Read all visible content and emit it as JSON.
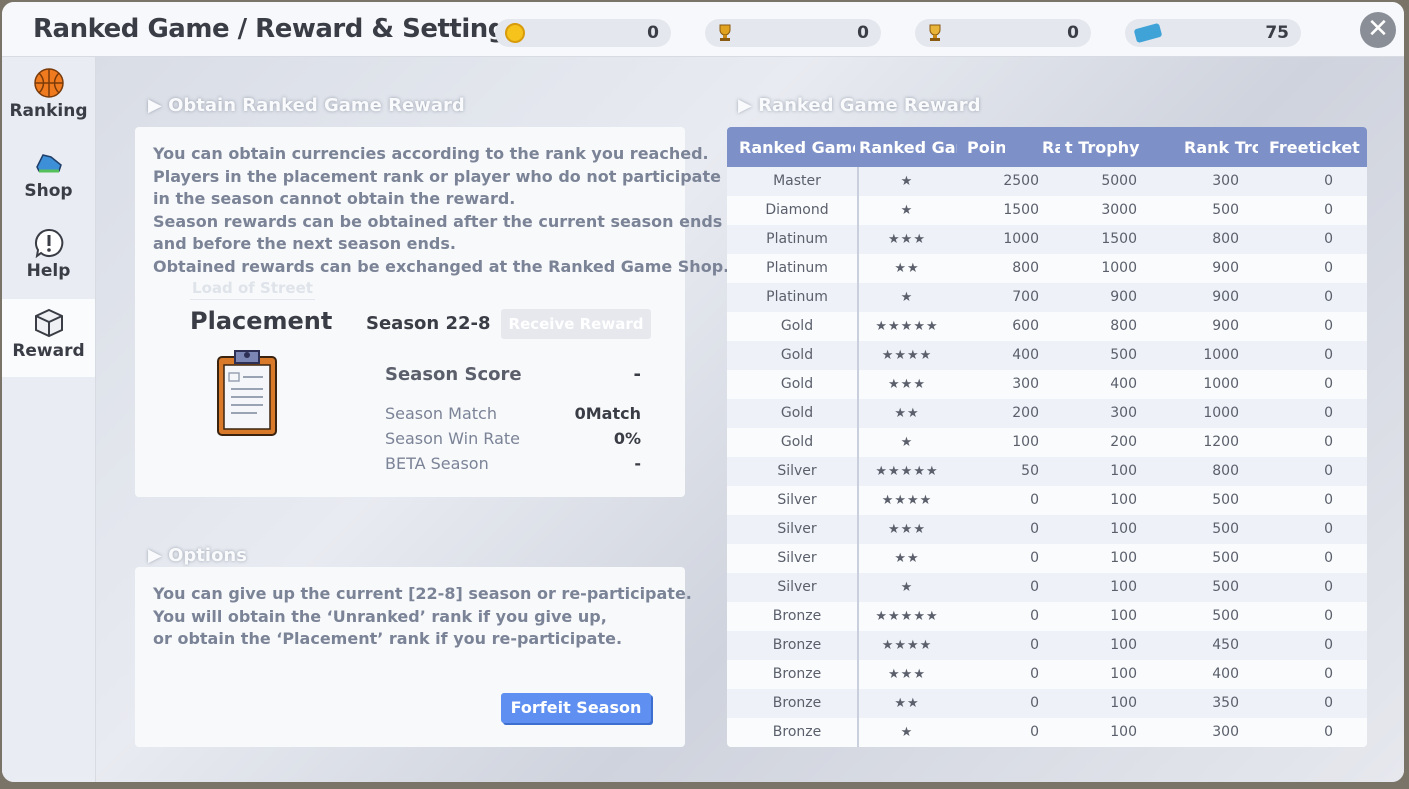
{
  "window": {
    "title": "Ranked Game / Reward & Settings"
  },
  "currencies": [
    {
      "icon": "coin-icon",
      "value": "0"
    },
    {
      "icon": "trophy-icon",
      "value": "0"
    },
    {
      "icon": "rank-trophy-icon",
      "value": "0"
    },
    {
      "icon": "ticket-icon",
      "value": "75"
    }
  ],
  "sidebar": {
    "items": [
      {
        "label": "Ranking",
        "icon": "basketball-icon"
      },
      {
        "label": "Shop",
        "icon": "sneaker-icon"
      },
      {
        "label": "Help",
        "icon": "exclamation-icon"
      },
      {
        "label": "Reward",
        "icon": "box-icon"
      }
    ]
  },
  "obtain": {
    "heading": "▶ Obtain Ranked Game Reward",
    "lines": [
      "You can obtain currencies according to the rank you reached.",
      "Players in the placement rank or player who do not participate",
      "in the season cannot obtain the reward.",
      "Season rewards can be obtained after the current season ends",
      "and before the next season ends.",
      "Obtained rewards can be exchanged at the Ranked Game Shop."
    ],
    "rank_subtitle": "Load of Street",
    "rank_name": "Placement",
    "season": "Season 22-8",
    "receive_button": "Receive Reward",
    "season_score_label": "Season Score",
    "season_score_value": "-",
    "stats": [
      {
        "label": "Season Match",
        "value": "0Match"
      },
      {
        "label": "Season Win Rate",
        "value": "0%"
      },
      {
        "label": "BETA Season",
        "value": "-"
      }
    ]
  },
  "options": {
    "heading": "▶ Options",
    "lines": [
      "You can give up the current [22-8] season or re-participate.",
      "You will obtain the ‘Unranked’ rank if you give up,",
      "or obtain the ‘Placement’ rank if you re-participate."
    ],
    "forfeit_button": "Forfeit Season"
  },
  "reward_table": {
    "heading": "▶ Ranked Game Reward",
    "columns": [
      "Ranked Game",
      "Ranked Gan",
      "Point",
      "Ra",
      "t Trophy",
      "Rank Tro",
      "Freeticket"
    ],
    "rows": [
      [
        "Master",
        "★",
        "2500",
        "5000",
        "300",
        "0"
      ],
      [
        "Diamond",
        "★",
        "1500",
        "3000",
        "500",
        "0"
      ],
      [
        "Platinum",
        "★★★",
        "1000",
        "1500",
        "800",
        "0"
      ],
      [
        "Platinum",
        "★★",
        "800",
        "1000",
        "900",
        "0"
      ],
      [
        "Platinum",
        "★",
        "700",
        "900",
        "900",
        "0"
      ],
      [
        "Gold",
        "★★★★★",
        "600",
        "800",
        "900",
        "0"
      ],
      [
        "Gold",
        "★★★★",
        "400",
        "500",
        "1000",
        "0"
      ],
      [
        "Gold",
        "★★★",
        "300",
        "400",
        "1000",
        "0"
      ],
      [
        "Gold",
        "★★",
        "200",
        "300",
        "1000",
        "0"
      ],
      [
        "Gold",
        "★",
        "100",
        "200",
        "1200",
        "0"
      ],
      [
        "Silver",
        "★★★★★",
        "50",
        "100",
        "800",
        "0"
      ],
      [
        "Silver",
        "★★★★",
        "0",
        "100",
        "500",
        "0"
      ],
      [
        "Silver",
        "★★★",
        "0",
        "100",
        "500",
        "0"
      ],
      [
        "Silver",
        "★★",
        "0",
        "100",
        "500",
        "0"
      ],
      [
        "Silver",
        "★",
        "0",
        "100",
        "500",
        "0"
      ],
      [
        "Bronze",
        "★★★★★",
        "0",
        "100",
        "500",
        "0"
      ],
      [
        "Bronze",
        "★★★★",
        "0",
        "100",
        "450",
        "0"
      ],
      [
        "Bronze",
        "★★★",
        "0",
        "100",
        "400",
        "0"
      ],
      [
        "Bronze",
        "★★",
        "0",
        "100",
        "350",
        "0"
      ],
      [
        "Bronze",
        "★",
        "0",
        "100",
        "300",
        "0"
      ]
    ]
  }
}
